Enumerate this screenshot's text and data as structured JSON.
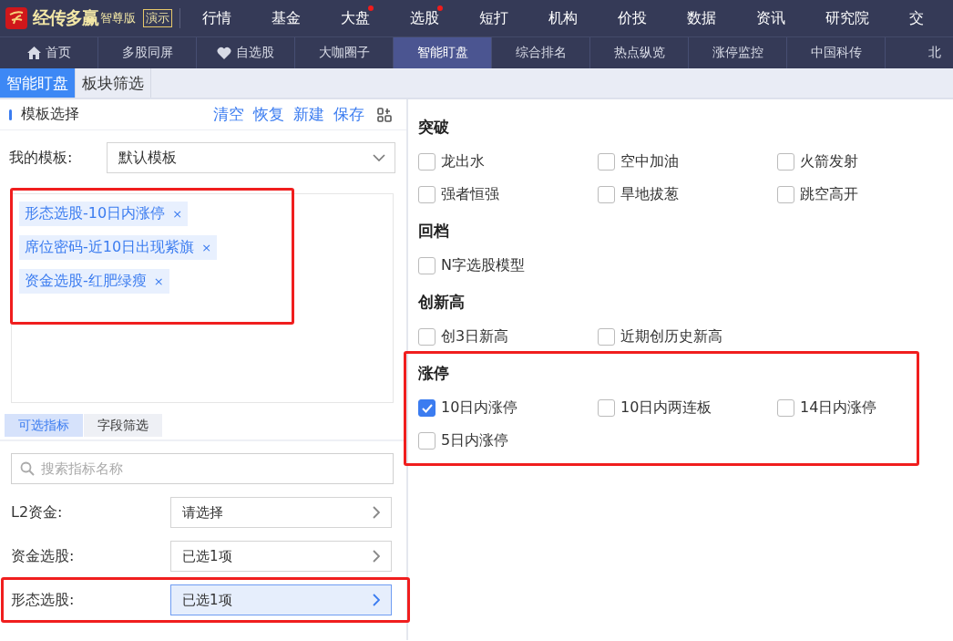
{
  "app": {
    "brand": "经传多赢",
    "edition": "智尊版",
    "mode_badge": "演示"
  },
  "main_menu": [
    {
      "label": "行情",
      "dot": false
    },
    {
      "label": "基金",
      "dot": false
    },
    {
      "label": "大盘",
      "dot": true
    },
    {
      "label": "选股",
      "dot": true
    },
    {
      "label": "短打",
      "dot": false
    },
    {
      "label": "机构",
      "dot": false
    },
    {
      "label": "价投",
      "dot": false
    },
    {
      "label": "数据",
      "dot": false
    },
    {
      "label": "资讯",
      "dot": false
    },
    {
      "label": "研究院",
      "dot": false
    },
    {
      "label": "交",
      "dot": false
    }
  ],
  "nav_tabs": [
    {
      "label": "首页",
      "kind": "home",
      "selected": false
    },
    {
      "label": "多股同屏",
      "kind": "plain",
      "selected": false
    },
    {
      "label": "自选股",
      "kind": "heart",
      "selected": false
    },
    {
      "label": "大咖圈子",
      "kind": "plain",
      "selected": false
    },
    {
      "label": "智能盯盘",
      "kind": "plain",
      "selected": true
    },
    {
      "label": "综合排名",
      "kind": "plain",
      "selected": false
    },
    {
      "label": "热点纵览",
      "kind": "plain",
      "selected": false
    },
    {
      "label": "涨停监控",
      "kind": "plain",
      "selected": false
    },
    {
      "label": "中国科传",
      "kind": "plain",
      "selected": false
    },
    {
      "label": "北",
      "kind": "plain",
      "selected": false
    }
  ],
  "sub_tabs": [
    {
      "label": "智能盯盘",
      "selected": true
    },
    {
      "label": "板块筛选",
      "selected": false
    }
  ],
  "template_panel": {
    "title": "模板选择",
    "actions": [
      "清空",
      "恢复",
      "新建",
      "保存"
    ],
    "my_template_label": "我的模板:",
    "my_template_value": "默认模板",
    "tags_highlighted": true,
    "tags": [
      {
        "label": "形态选股-10日内涨停",
        "remove": "×"
      },
      {
        "label": "席位密码-近10日出现紫旗",
        "remove": "×"
      },
      {
        "label": "资金选股-红肥绿瘦",
        "remove": "×"
      }
    ]
  },
  "indicator_tabs": [
    {
      "label": "可选指标",
      "selected": true
    },
    {
      "label": "字段筛选",
      "selected": false
    }
  ],
  "search": {
    "placeholder": "搜索指标名称"
  },
  "indicator_rows": [
    {
      "label": "L2资金:",
      "value": "请选择",
      "selected": false,
      "highlighted": false
    },
    {
      "label": "资金选股:",
      "value": "已选1项",
      "selected": false,
      "highlighted": false
    },
    {
      "label": "形态选股:",
      "value": "已选1项",
      "selected": true,
      "highlighted": true
    }
  ],
  "groups": [
    {
      "title": "突破",
      "highlighted": false,
      "options": [
        {
          "label": "龙出水",
          "checked": false
        },
        {
          "label": "空中加油",
          "checked": false
        },
        {
          "label": "火箭发射",
          "checked": false
        },
        {
          "label": "强者恒强",
          "checked": false
        },
        {
          "label": "旱地拔葱",
          "checked": false
        },
        {
          "label": "跳空高开",
          "checked": false
        }
      ]
    },
    {
      "title": "回档",
      "highlighted": false,
      "options": [
        {
          "label": "N字选股模型",
          "checked": false
        }
      ]
    },
    {
      "title": "创新高",
      "highlighted": false,
      "options": [
        {
          "label": "创3日新高",
          "checked": false
        },
        {
          "label": "近期创历史新高",
          "checked": false
        }
      ]
    },
    {
      "title": "涨停",
      "highlighted": true,
      "options": [
        {
          "label": "10日内涨停",
          "checked": true
        },
        {
          "label": "10日内两连板",
          "checked": false
        },
        {
          "label": "14日内涨停",
          "checked": false
        },
        {
          "label": "5日内涨停",
          "checked": false
        }
      ]
    }
  ]
}
